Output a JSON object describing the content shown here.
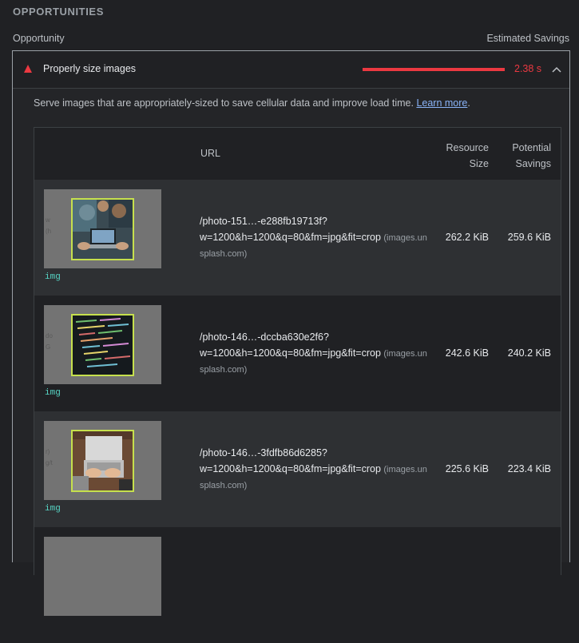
{
  "section": {
    "title": "OPPORTUNITIES"
  },
  "columns": {
    "left": "Opportunity",
    "right": "Estimated Savings"
  },
  "audit": {
    "title": "Properly size images",
    "savings": "2.38 s",
    "savings_fraction": 1.0,
    "expanded": true,
    "icon": "fail-triangle-icon",
    "description": "Serve images that are appropriately-sized to save cellular data and improve load time.",
    "learn_more": "Learn more",
    "desc_end": "."
  },
  "table": {
    "headers": {
      "url": "URL",
      "resource_size_1": "Resource",
      "resource_size_2": "Size",
      "potential_savings_1": "Potential",
      "potential_savings_2": "Savings"
    },
    "rows": [
      {
        "node": "img",
        "url_line1": "/photo-151…-e288fb19713f?",
        "url_line2": "w=1200&h=1200&q=80&fm=jpg&fit=crop",
        "origin_a": "(images.un",
        "origin_b": "splash.com)",
        "ghost": "w\n(h",
        "resource_size": "262.2 KiB",
        "potential_savings": "259.6 KiB"
      },
      {
        "node": "img",
        "url_line1": "/photo-146…-dccba630e2f6?",
        "url_line2": "w=1200&h=1200&q=80&fm=jpg&fit=crop",
        "origin_a": "(images.un",
        "origin_b": "splash.com)",
        "ghost": "do\nG",
        "resource_size": "242.6 KiB",
        "potential_savings": "240.2 KiB"
      },
      {
        "node": "img",
        "url_line1": "/photo-146…-3fdfb86d6285?",
        "url_line2": "w=1200&h=1200&q=80&fm=jpg&fit=crop",
        "origin_a": "(images.un",
        "origin_b": "splash.com)",
        "ghost": "r)\ng/t",
        "resource_size": "225.6 KiB",
        "potential_savings": "223.4 KiB"
      }
    ]
  },
  "colors": {
    "fail": "#eb3941",
    "highlight": "#c6e04d",
    "node": "#56d3c3",
    "link": "#8ab4f8"
  }
}
